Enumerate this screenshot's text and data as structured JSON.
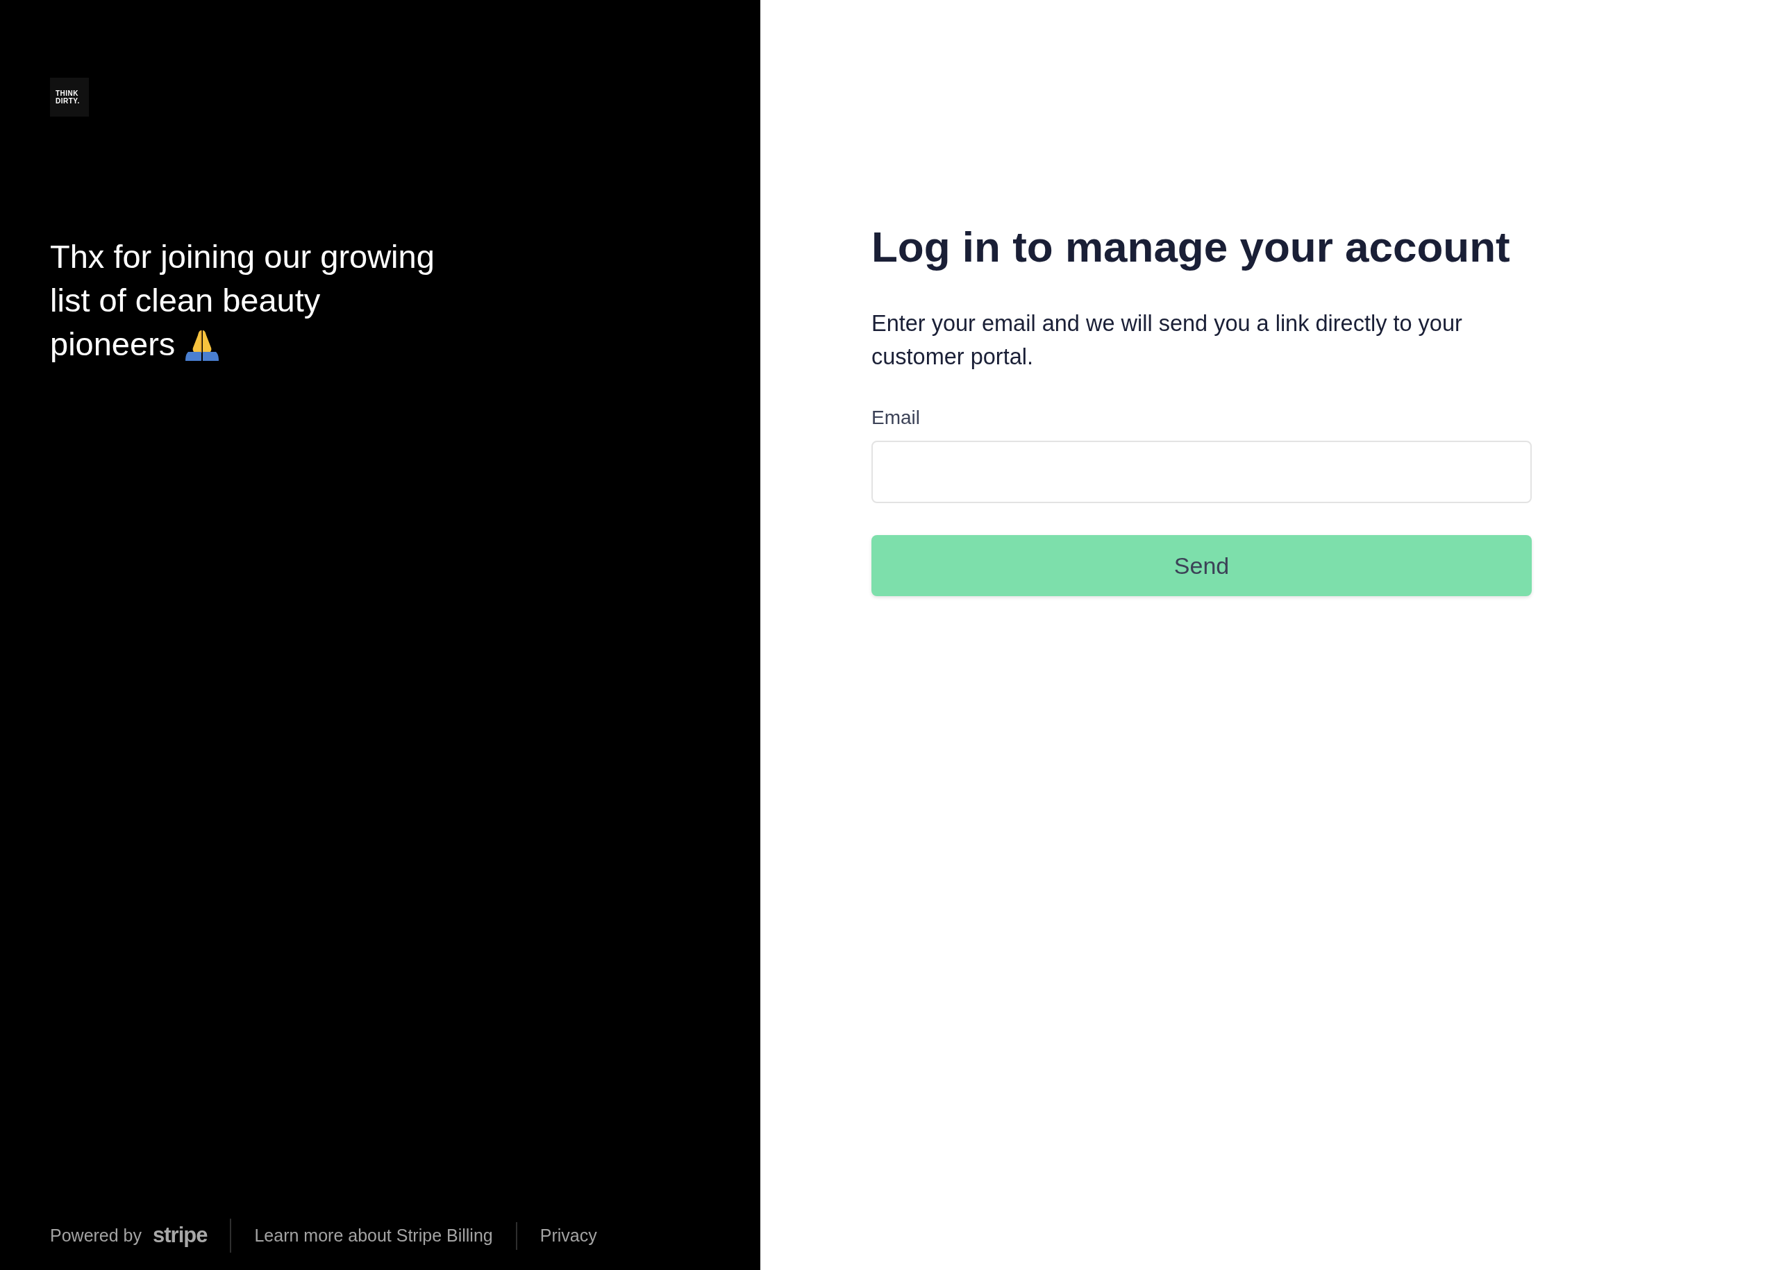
{
  "brand": {
    "logo_lines": [
      "THINK",
      "DIRTY."
    ]
  },
  "tagline_lines": [
    "Thx for joining our growing",
    "list of clean beauty",
    "pioneers"
  ],
  "footer": {
    "powered_by": "Powered by",
    "powered_by_logo": "stripe",
    "links": [
      "Learn more about Stripe Billing",
      "Privacy"
    ]
  },
  "form": {
    "title": "Log in to manage your account",
    "description": "Enter your email and we will send you a link directly to your customer portal.",
    "fields": [
      {
        "label": "Email"
      }
    ],
    "submit": "Send"
  }
}
